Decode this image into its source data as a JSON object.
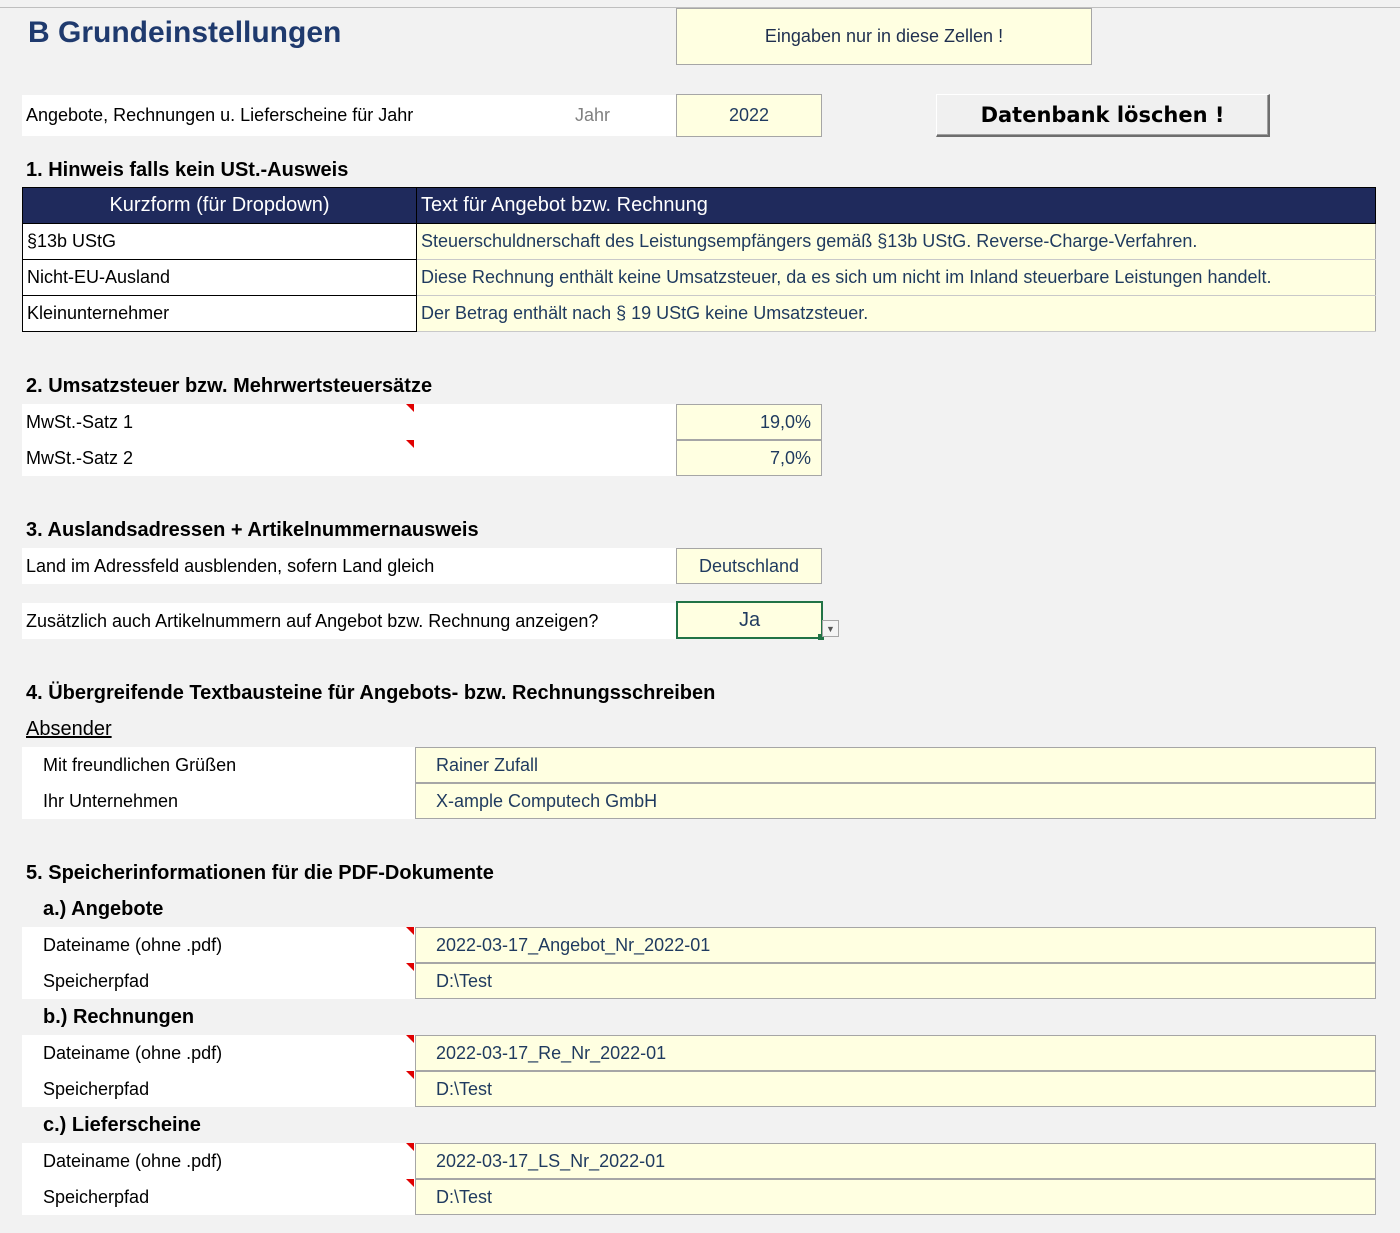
{
  "page": {
    "title": "B  Grundeinstellungen",
    "hint": "Eingaben nur in diese Zellen !"
  },
  "year_row": {
    "label": "Angebote, Rechnungen u. Lieferscheine für Jahr",
    "sublabel": "Jahr",
    "value": "2022"
  },
  "delete_button": {
    "label": "Datenbank löschen !"
  },
  "section1": {
    "heading": "1. Hinweis falls kein USt.-Ausweis",
    "columns": [
      "Kurzform (für Dropdown)",
      "Text für Angebot bzw. Rechnung"
    ],
    "rows": [
      {
        "short": "§13b UStG",
        "text": "Steuerschuldnerschaft des Leistungsempfängers gemäß §13b UStG. Reverse-Charge-Verfahren."
      },
      {
        "short": "Nicht-EU-Ausland",
        "text": "Diese Rechnung enthält keine Umsatzsteuer, da es sich um nicht im Inland steuerbare Leistungen handelt."
      },
      {
        "short": "Kleinunternehmer",
        "text": "Der Betrag enthält nach § 19 UStG keine Umsatzsteuer."
      }
    ]
  },
  "section2": {
    "heading": "2. Umsatzsteuer bzw. Mehrwertsteuersätze",
    "rates": [
      {
        "label": "MwSt.-Satz 1",
        "value": "19,0%"
      },
      {
        "label": "MwSt.-Satz 2",
        "value": "7,0%"
      }
    ]
  },
  "section3": {
    "heading": "3. Auslandsadressen + Artikelnummernausweis",
    "country_label": "Land im Adressfeld ausblenden, sofern Land gleich",
    "country_value": "Deutschland",
    "artno_label": "Zusätzlich auch Artikelnummern auf Angebot bzw. Rechnung anzeigen?",
    "artno_value": "Ja"
  },
  "section4": {
    "heading": "4. Übergreifende Textbausteine für Angebots- bzw. Rechnungsschreiben",
    "sender_label": "Absender",
    "closing_label": "Mit freundlichen Grüßen",
    "closing_value": "Rainer Zufall",
    "company_label": "Ihr Unternehmen",
    "company_value": "X-ample Computech GmbH"
  },
  "section5": {
    "heading": "5. Speicherinformationen für die PDF-Dokumente",
    "groups": [
      {
        "title": "a.) Angebote",
        "file_label": "Dateiname (ohne .pdf)",
        "file_value": "2022-03-17_Angebot_Nr_2022-01",
        "path_label": "Speicherpfad",
        "path_value": "D:\\Test"
      },
      {
        "title": "b.) Rechnungen",
        "file_label": "Dateiname (ohne .pdf)",
        "file_value": "2022-03-17_Re_Nr_2022-01",
        "path_label": "Speicherpfad",
        "path_value": "D:\\Test"
      },
      {
        "title": "c.) Lieferscheine",
        "file_label": "Dateiname (ohne .pdf)",
        "file_value": "2022-03-17_LS_Nr_2022-01",
        "path_label": "Speicherpfad",
        "path_value": "D:\\Test"
      }
    ]
  },
  "colors": {
    "input_fill": "#ffffe1",
    "header_fill": "#1f2a5c",
    "title_color": "#1f3a6e",
    "comment_flag": "#e00000",
    "selection": "#217346"
  }
}
